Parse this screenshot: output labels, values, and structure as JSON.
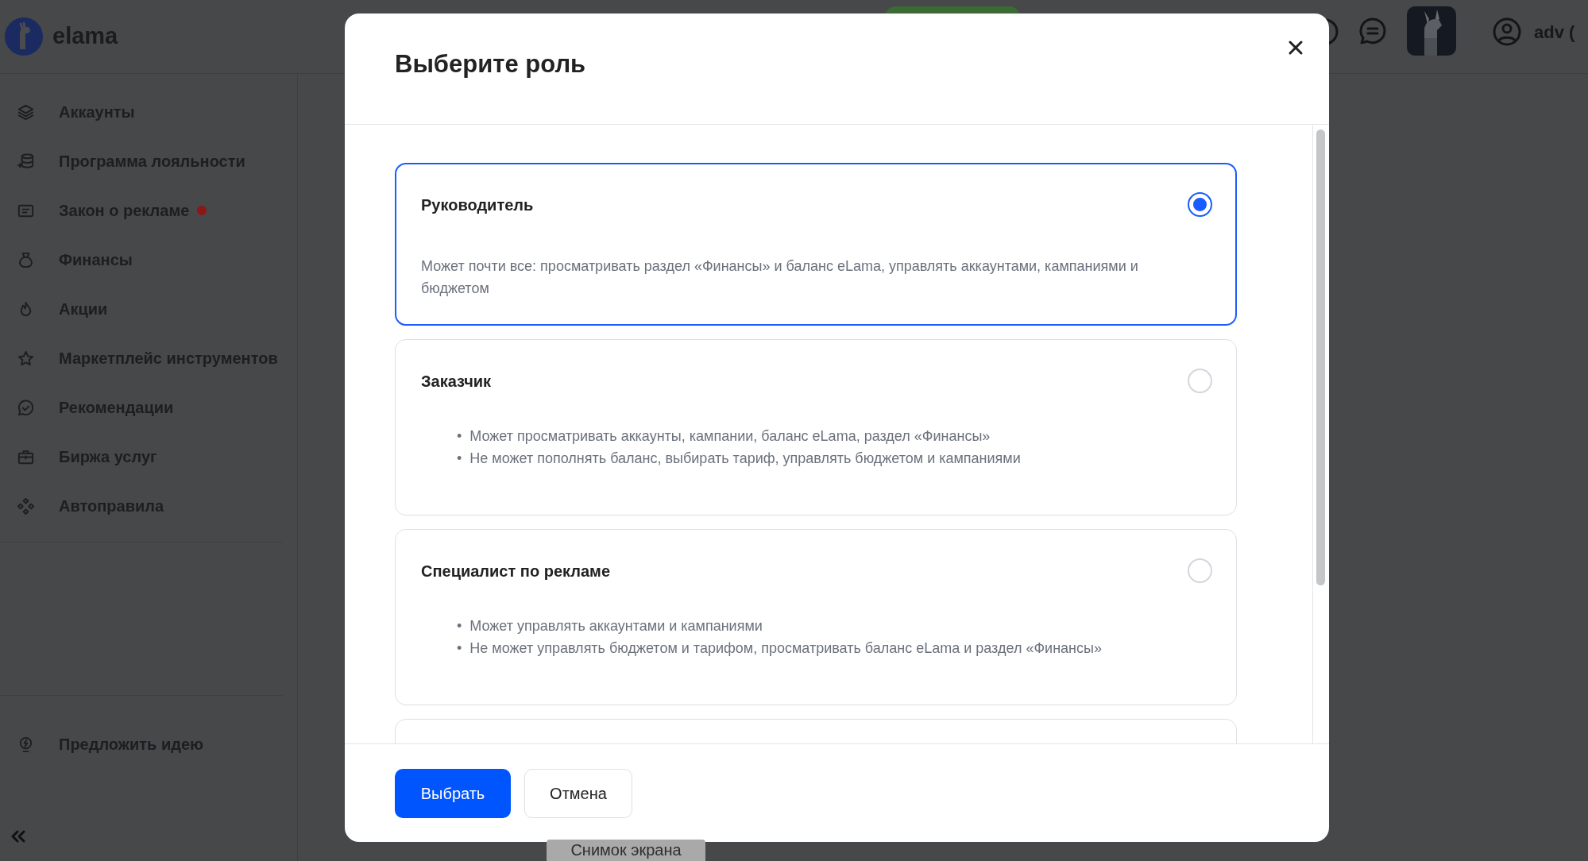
{
  "app": {
    "logo": "elama"
  },
  "topbar": {
    "user": "adv ("
  },
  "sidebar": {
    "items": [
      {
        "label": "Аккаунты",
        "notification": false
      },
      {
        "label": "Программа лояльности",
        "notification": false
      },
      {
        "label": "Закон о рекламе",
        "notification": true
      },
      {
        "label": "Финансы",
        "notification": false
      },
      {
        "label": "Акции",
        "notification": false
      },
      {
        "label": "Маркетплейс инструментов",
        "notification": false
      },
      {
        "label": "Рекомендации",
        "notification": false
      },
      {
        "label": "Биржа услуг",
        "notification": false
      },
      {
        "label": "Автоправила",
        "notification": false
      }
    ],
    "footer_items": [
      {
        "label": "Предложить идею"
      }
    ]
  },
  "modal": {
    "title": "Выберите роль",
    "roles": [
      {
        "title": "Руководитель",
        "selected": true,
        "kind": "paragraph",
        "description": "Может почти все: просматривать раздел «Финансы» и баланс eLama, управлять аккаунтами, кампаниями и бюджетом"
      },
      {
        "title": "Заказчик",
        "selected": false,
        "kind": "bullets",
        "bullets": [
          {
            "marker": "•",
            "text": "Может просматривать аккаунты, кампании, баланс eLama, раздел «Финансы»"
          },
          {
            "marker": "•",
            "text": "Не может пополнять баланс, выбирать тариф, управлять бюджетом и кампаниями"
          }
        ]
      },
      {
        "title": "Специалист по рекламе",
        "selected": false,
        "kind": "bullets",
        "bullets": [
          {
            "marker": "•",
            "text": "Может управлять аккаунтами и кампаниями"
          },
          {
            "marker": "•",
            "text": "Не может управлять бюджетом и тарифом, просматривать баланс eLama и раздел «Финансы»"
          }
        ]
      }
    ],
    "more_below": true,
    "buttons": [
      {
        "label": "Выбрать",
        "kind": "primary"
      },
      {
        "label": "Отмена",
        "kind": "secondary"
      }
    ]
  },
  "screenshot_tooltip": "Снимок экрана"
}
